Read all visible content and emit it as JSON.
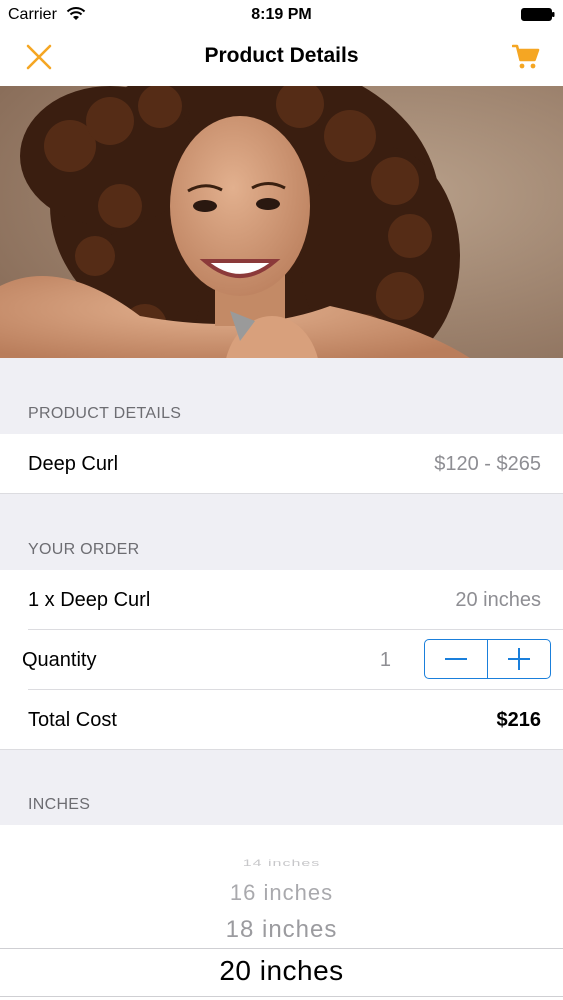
{
  "status_bar": {
    "carrier": "Carrier",
    "time": "8:19 PM"
  },
  "nav": {
    "title": "Product Details",
    "close_icon": "close-icon",
    "cart_icon": "cart-icon",
    "accent_color": "#f5a623"
  },
  "hero": {
    "image": "woman-curly-hair-photo"
  },
  "product_section": {
    "header": "PRODUCT DETAILS",
    "product_name": "Deep Curl",
    "price_range": "$120 - $265"
  },
  "order_section": {
    "header": "YOUR ORDER",
    "item_label": "1 x Deep Curl",
    "item_length": "20 inches",
    "quantity_label": "Quantity",
    "quantity_value": "1",
    "stepper_color": "#1a7fdb",
    "total_label": "Total Cost",
    "total_value": "$216"
  },
  "inches_section": {
    "header": "INCHES",
    "options": [
      "14 inches",
      "16 inches",
      "18 inches",
      "20 inches"
    ],
    "selected": "20 inches"
  }
}
